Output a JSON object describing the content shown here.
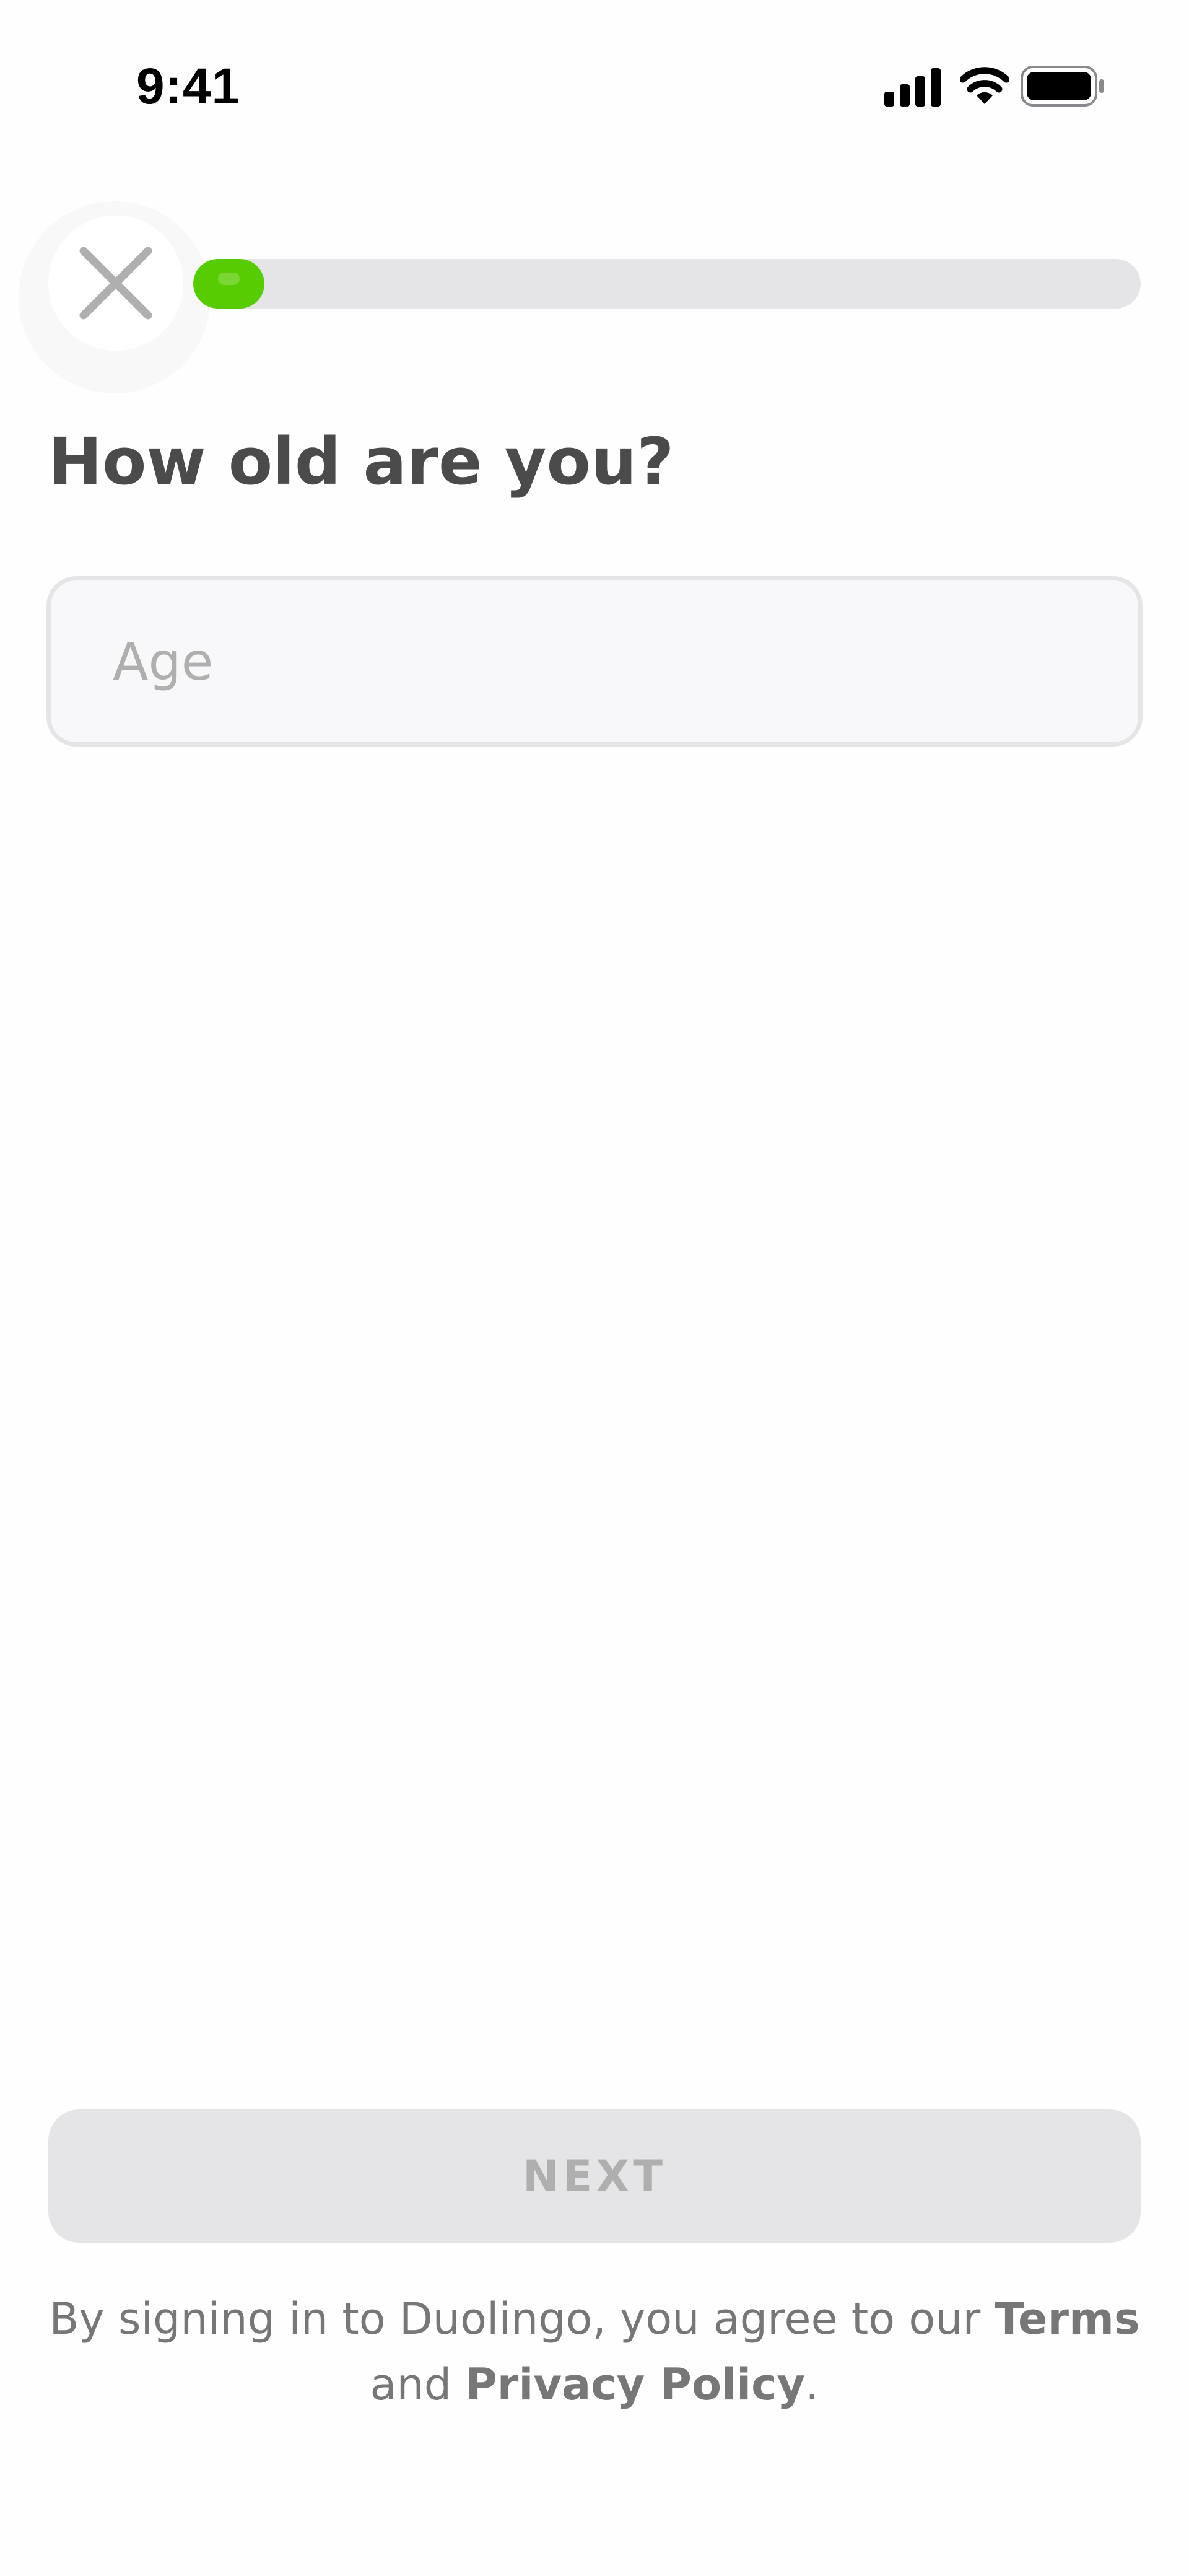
{
  "status_bar": {
    "time": "9:41",
    "icons": [
      "cellular-signal-icon",
      "wifi-icon",
      "battery-icon"
    ]
  },
  "header": {
    "close_icon": "close-icon",
    "progress": 0.075
  },
  "question": {
    "title": "How old are you?"
  },
  "age_input": {
    "value": "",
    "placeholder": "Age"
  },
  "footer": {
    "next_label": "NEXT",
    "legal": {
      "prefix": "By signing in to Duolingo, you agree to our ",
      "terms_label": "Terms",
      "middle": " and ",
      "privacy_label": "Privacy Policy",
      "suffix": "."
    }
  },
  "colors": {
    "progress_fill": "#58cc02",
    "progress_track": "#e5e5e8",
    "title_text": "#4b4b4b",
    "disabled_button": "#e5e5e8",
    "disabled_text": "#afafaf"
  }
}
